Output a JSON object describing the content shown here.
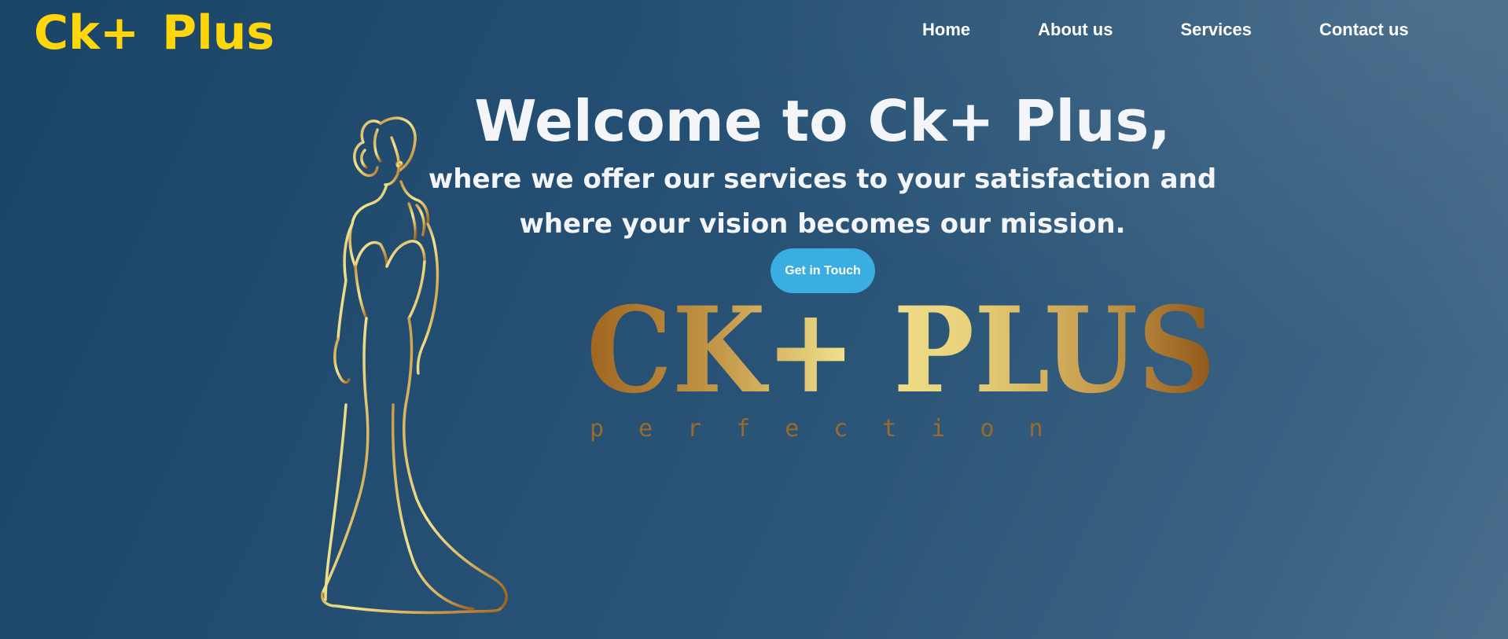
{
  "logo": {
    "text": "Ck+ Plus"
  },
  "nav": {
    "items": [
      {
        "label": "Home"
      },
      {
        "label": "About us"
      },
      {
        "label": "Services"
      },
      {
        "label": "Contact us"
      }
    ]
  },
  "hero": {
    "title": "Welcome to Ck+ Plus,",
    "line1": "where we offer our services to your satisfaction and",
    "line2": "where your vision becomes our mission.",
    "cta_label": "Get in Touch"
  },
  "brand_image": {
    "wordmark": "CK+ PLUS",
    "tagline": "perfection",
    "illustration": "woman-in-gown-line-art"
  },
  "colors": {
    "logo": "#ffd60a",
    "cta": "#3aaee0",
    "gold_dark": "#a0651f",
    "gold_light": "#f2e48f",
    "background": "#234e72"
  }
}
